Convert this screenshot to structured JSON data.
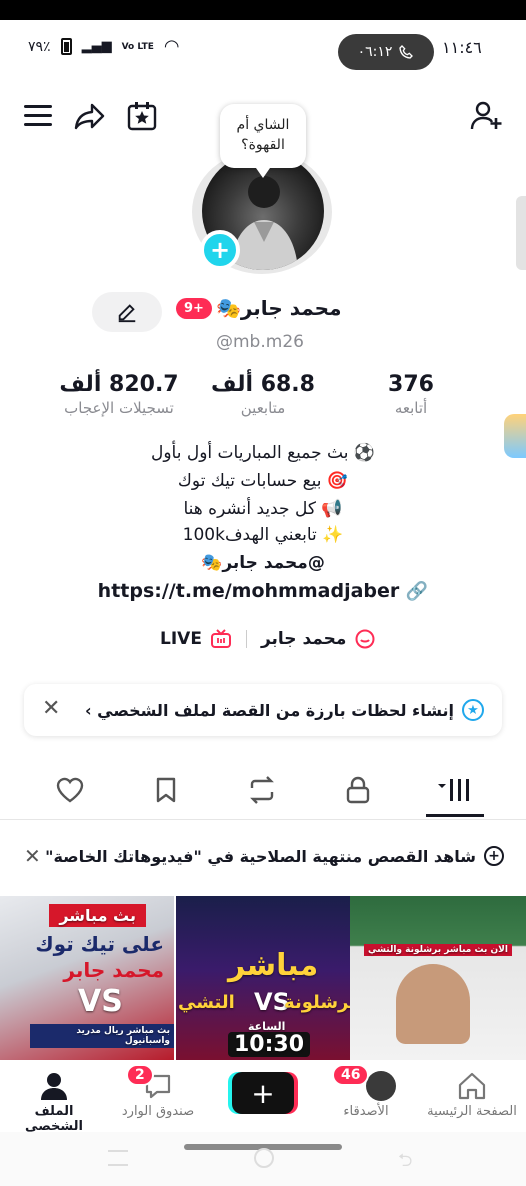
{
  "status_bar": {
    "battery_pct": "٧٩٪",
    "network": "Vo LTE",
    "call_timer": "٠٦:١٢",
    "time": "١١:٤٦"
  },
  "profile": {
    "bubble_text": "الشاي أم القهوة؟",
    "name": "محمد جابر🎭",
    "badge": "9+",
    "handle": "@mb.m26"
  },
  "stats": [
    {
      "value": "376",
      "label": "أتابعه"
    },
    {
      "value": "68.8 ألف",
      "label": "متابعين"
    },
    {
      "value": "820.7 ألف",
      "label": "تسجيلات الإعجاب"
    }
  ],
  "bio_lines": [
    "⚽ بث جميع المباريات أول بأول",
    "🎯 بيع حسابات تيك توك",
    "📢 كل جديد أنشره هنا",
    "✨ تابعني الهدف100k",
    "@محمد جابر🎭"
  ],
  "link": "https://t.me/mohmmadjaber",
  "meta": {
    "linked_account": "محمد جابر",
    "live_label": "LIVE"
  },
  "story_banner": {
    "text": "إنشاء لحظات بارزة من القصة لملف الشخصي ›"
  },
  "notice": {
    "text": "شاهد القصص منتهية الصلاحية في \"فيديوهاتك الخاصة\""
  },
  "thumbnails": [
    {
      "top": "بث مباشر",
      "title": "على تيك توك",
      "sub": "محمد جابر",
      "bottom": "بث مباشر ريال مدريد واسبانيول",
      "vs": "VS"
    },
    {
      "top": "مباشر",
      "vs": "VS",
      "left_team": "التشي",
      "right_team": "برشلونة",
      "label": "الساعة",
      "time": "10:30"
    },
    {
      "caption": "الان بث مباشر برشلونة والتشي"
    }
  ],
  "bottom_nav": [
    {
      "label": "الصفحة الرئيسية"
    },
    {
      "label": "الأصدقاء",
      "count": "46"
    },
    {
      "label": "صندوق الوارد",
      "count": "2"
    },
    {
      "label": "الملف الشخصي"
    }
  ],
  "colors": {
    "accent_red": "#fe2c55",
    "accent_cyan": "#20d5ec",
    "text_primary": "#161823",
    "text_secondary": "#8a8b91"
  }
}
